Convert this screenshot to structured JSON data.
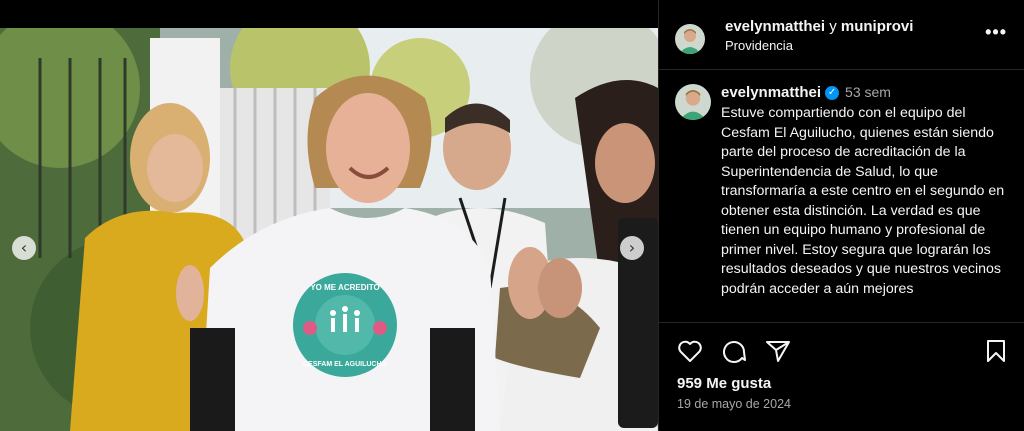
{
  "post": {
    "nav": {
      "prev_icon": "‹",
      "next_icon": "›"
    }
  },
  "header": {
    "user1": "evelynmatthei",
    "separator": "y",
    "user2": "muniprovi",
    "location": "Providencia",
    "more_icon": "•••"
  },
  "caption": {
    "username": "evelynmatthei",
    "verified_icon": "✓",
    "time": "53 sem",
    "text": "Estuve compartiendo con el equipo del Cesfam El Aguilucho, quienes están siendo parte del proceso de acreditación de la Superintendencia de Salud, lo que transformaría a este centro en el segundo en obtener esta distinción. La verdad es que tienen un equipo humano y profesional de primer nivel. Estoy segura que lograrán los resultados deseados y que nuestros vecinos podrán acceder a aún mejores"
  },
  "actions": {
    "likes": "959 Me gusta",
    "date": "19 de mayo de 2024"
  },
  "photo": {
    "shirt_print_top": "YO ME ACREDITO",
    "shirt_print_bottom": "CESFAM EL AGUILUCHO"
  },
  "colors": {
    "background": "#000000",
    "text": "#f5f5f5",
    "secondary_text": "#a8a8a8",
    "verified": "#0095f6",
    "shirt_badge": "#3aa89a"
  }
}
